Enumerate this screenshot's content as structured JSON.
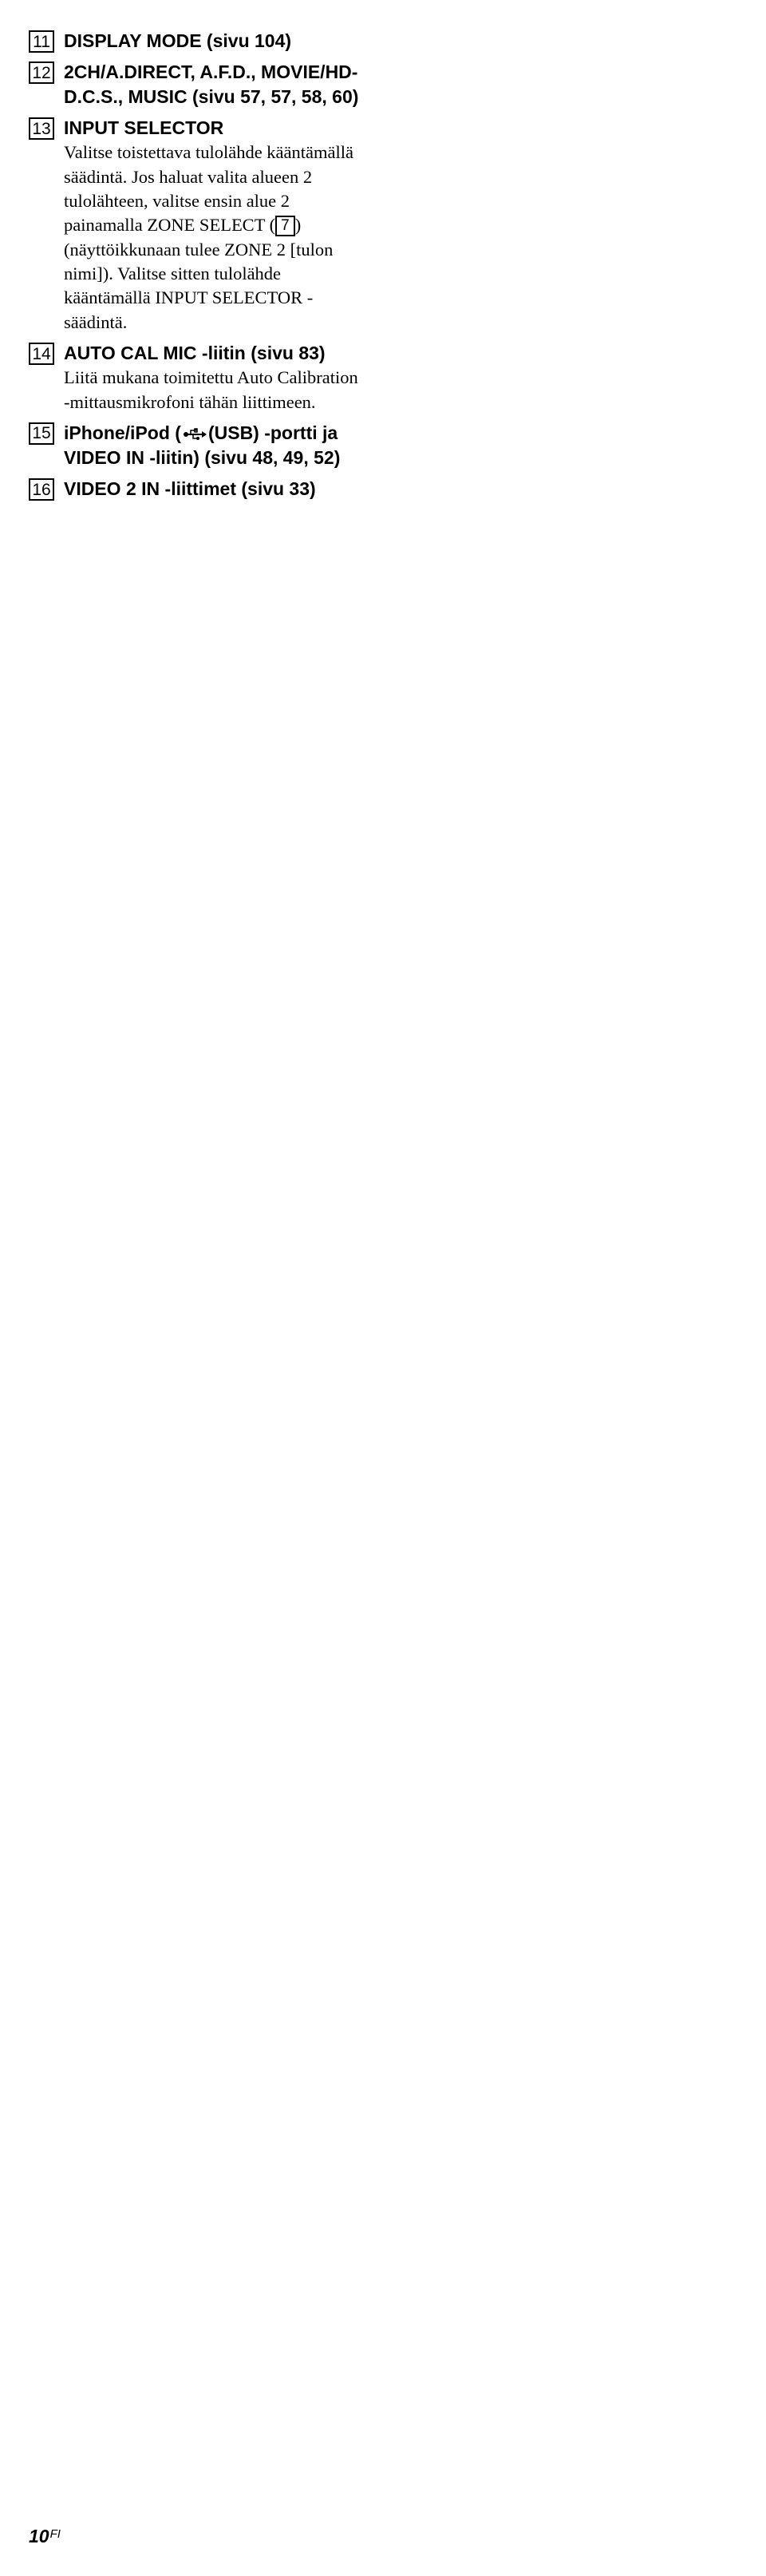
{
  "items": [
    {
      "num": "11",
      "heading": "DISPLAY MODE (sivu 104)",
      "body": ""
    },
    {
      "num": "12",
      "heading": "2CH/A.DIRECT, A.F.D., MOVIE/HD-D.C.S., MUSIC (sivu 57, 57, 58, 60)",
      "body": ""
    },
    {
      "num": "13",
      "heading": "INPUT SELECTOR",
      "body_before": "Valitse toistettava tulolähde kääntämällä säädintä.\nJos haluat valita alueen 2 tulolähteen, valitse ensin alue 2 painamalla ZONE SELECT (",
      "inline_box": "7",
      "body_after": ") (näyttöikkunaan tulee ZONE 2 [tulon nimi]). Valitse sitten tulolähde kääntämällä INPUT SELECTOR -säädintä."
    },
    {
      "num": "14",
      "heading": "AUTO CAL MIC -liitin (sivu 83)",
      "body": "Liitä mukana toimitettu Auto Calibration -mittausmikrofoni tähän liittimeen."
    },
    {
      "num": "15",
      "heading_before": "iPhone/iPod (",
      "heading_after": "(USB) -portti ja VIDEO IN -liitin) (sivu 48, 49, 52)",
      "has_usb_icon": true,
      "body": ""
    },
    {
      "num": "16",
      "heading": "VIDEO 2 IN -liittimet (sivu 33)",
      "body": ""
    }
  ],
  "footer": {
    "page": "10",
    "suffix": "FI"
  }
}
